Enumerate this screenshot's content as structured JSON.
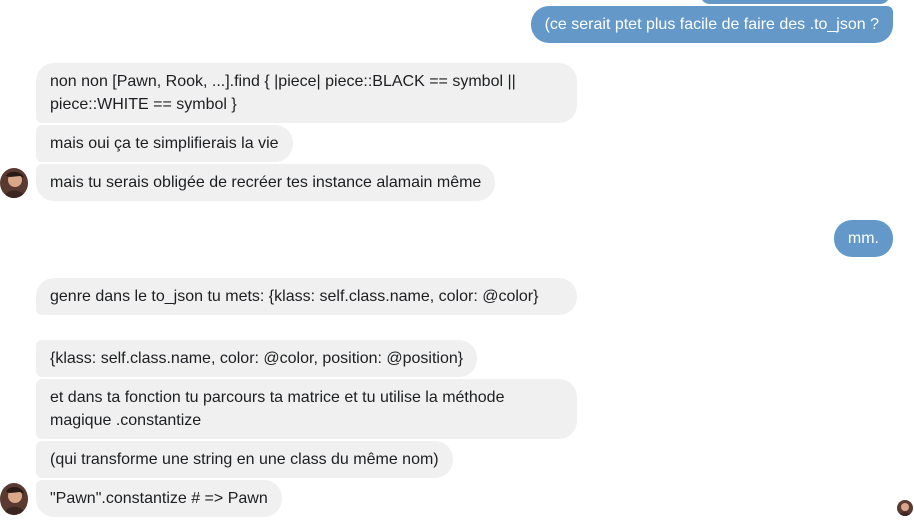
{
  "conversation": {
    "outgoing": [
      {
        "text": "(ce serait ptet plus facile de faire des .to_json ?"
      },
      {
        "text": "mm."
      }
    ],
    "group1": [
      {
        "text": "non non [Pawn, Rook, ...].find { |piece| piece::BLACK == symbol || piece::WHITE == symbol }"
      },
      {
        "text": "mais oui ça te simplifierais la vie"
      },
      {
        "text": "mais tu serais obligée de recréer tes instance alamain même"
      }
    ],
    "group2": [
      {
        "text": "genre dans le to_json tu mets: {klass: self.class.name, color: @color}"
      },
      {
        "text": "{klass: self.class.name, color: @color, position: @position}"
      },
      {
        "text": "et dans ta fonction tu parcours ta matrice et tu utilise la méthode magique .constantize"
      },
      {
        "text": "(qui transforme une string en une class du même nom)"
      },
      {
        "text": "\"Pawn\".constantize # => Pawn"
      }
    ]
  },
  "colors": {
    "outgoing_bubble": "#6398c9",
    "incoming_bubble": "#f0f0f0"
  },
  "icons": {
    "contact_avatar": "avatar-icon",
    "read_receipt": "seen-avatar-icon"
  }
}
